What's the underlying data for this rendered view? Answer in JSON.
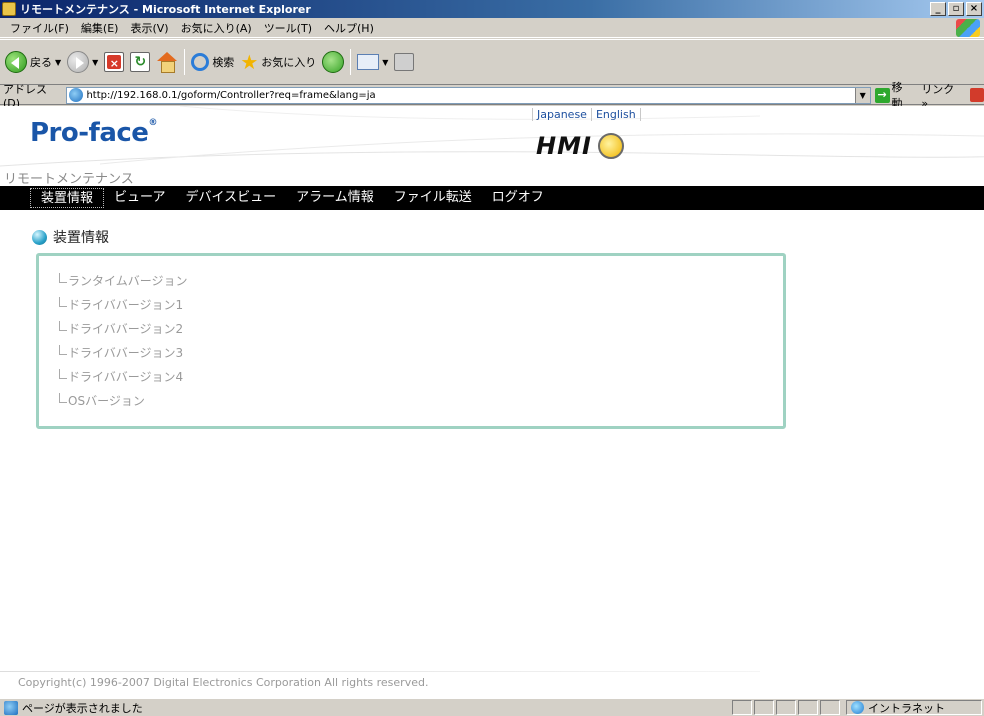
{
  "window": {
    "title": "リモートメンテナンス - Microsoft Internet Explorer"
  },
  "menubar": [
    "ファイル(F)",
    "編集(E)",
    "表示(V)",
    "お気に入り(A)",
    "ツール(T)",
    "ヘルプ(H)"
  ],
  "toolbar": {
    "back_label": "戻る",
    "search_label": "検索",
    "favorites_label": "お気に入り"
  },
  "address": {
    "label": "アドレス(D)",
    "url": "http://192.168.0.1/goform/Controller?req=frame&lang=ja",
    "go_label": "移動",
    "links_label": "リンク »"
  },
  "page": {
    "lang": [
      "Japanese",
      "English"
    ],
    "brand": "Pro-face",
    "hmi_logo": "HMI",
    "title": "リモートメンテナンス",
    "nav": [
      "装置情報",
      "ビューア",
      "デバイスビュー",
      "アラーム情報",
      "ファイル転送",
      "ログオフ"
    ],
    "active_nav_index": 0,
    "section_heading": "装置情報",
    "info_items": [
      "ランタイムバージョン",
      "ドライババージョン1",
      "ドライババージョン2",
      "ドライババージョン3",
      "ドライババージョン4",
      "OSバージョン"
    ],
    "copyright": "Copyright(c) 1996-2007 Digital Electronics Corporation All rights reserved."
  },
  "status": {
    "text": "ページが表示されました",
    "zone": "イントラネット"
  },
  "colors": {
    "navbar": "#000000",
    "panel_border": "#9fd2c2",
    "brand": "#1a56a8"
  },
  "icons": [
    "back-icon",
    "forward-icon",
    "stop-icon",
    "refresh-icon",
    "home-icon",
    "search-icon",
    "favorites-icon",
    "history-icon",
    "mail-icon",
    "print-icon",
    "ie-icon",
    "go-icon",
    "globe-icon"
  ]
}
